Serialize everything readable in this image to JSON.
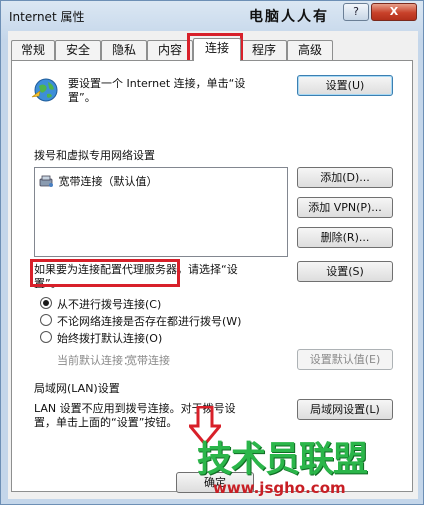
{
  "window": {
    "title": "Internet 属性",
    "help_label": "?",
    "close_label": "X",
    "watermark_top": "电脑人人有"
  },
  "tabs": [
    {
      "label": "常规"
    },
    {
      "label": "安全"
    },
    {
      "label": "隐私"
    },
    {
      "label": "内容"
    },
    {
      "label": "连接",
      "active": true
    },
    {
      "label": "程序"
    },
    {
      "label": "高级"
    }
  ],
  "setup": {
    "text_line1": "要设置一个 Internet 连接，单击“设",
    "text_line2": "置”。",
    "button_label": "设置(U)"
  },
  "dialup": {
    "section_label": "拨号和虚拟专用网络设置",
    "connections": [
      {
        "name": "宽带连接（默认值）",
        "icon": "dialup-connection-icon"
      }
    ],
    "add_label": "添加(D)...",
    "add_vpn_label": "添加 VPN(P)...",
    "remove_label": "删除(R)...",
    "proxy_text_line1": "如果要为连接配置代理服务器，请选择“设",
    "proxy_text_line2": "置”。",
    "settings_label": "设置(S)",
    "radio_never": "从不进行拨号连接(C)",
    "radio_no_network": "不论网络连接是否存在都进行拨号(W)",
    "radio_always": "始终拨打默认连接(O)",
    "current_default_label": "当前默认连接：",
    "current_default_value": "宽带连接",
    "set_default_label": "设置默认值(E)"
  },
  "lan": {
    "section_label": "局域网(LAN)设置",
    "text_line1": "LAN 设置不应用到拨号连接。对于拨号设",
    "text_line2": "置，单击上面的“设置”按钮。",
    "button_label": "局域网设置(L)"
  },
  "footer": {
    "ok_label": "确定",
    "watermark_brand": "技术员联盟",
    "watermark_url": "www.jsgho.com"
  },
  "colors": {
    "highlight": "#d8202a",
    "watermark_green": "#2bb64a",
    "watermark_red": "#c81e24"
  }
}
